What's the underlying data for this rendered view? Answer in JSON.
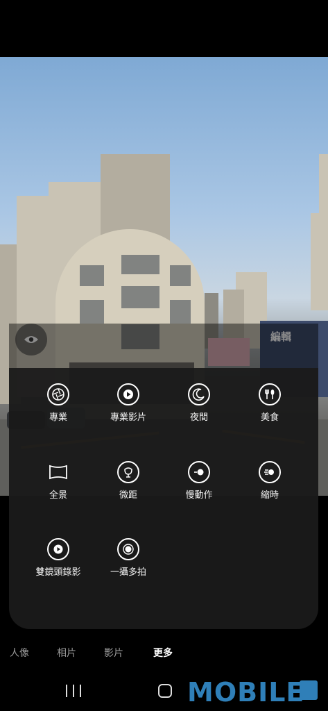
{
  "viewfinder": {
    "edit_label": "編輯"
  },
  "modes": [
    {
      "label": "專業",
      "icon": "aperture-icon"
    },
    {
      "label": "專業影片",
      "icon": "video-play-icon"
    },
    {
      "label": "夜間",
      "icon": "moon-icon"
    },
    {
      "label": "美食",
      "icon": "food-utensils-icon"
    },
    {
      "label": "全景",
      "icon": "panorama-icon"
    },
    {
      "label": "微距",
      "icon": "flower-icon"
    },
    {
      "label": "慢動作",
      "icon": "slow-motion-icon"
    },
    {
      "label": "縮時",
      "icon": "hyperlapse-icon"
    },
    {
      "label": "雙鏡頭錄影",
      "icon": "dual-record-icon"
    },
    {
      "label": "一攝多拍",
      "icon": "single-take-icon"
    }
  ],
  "tabs": [
    {
      "label": "人像"
    },
    {
      "label": "相片"
    },
    {
      "label": "影片"
    },
    {
      "label": "更多",
      "active": true
    }
  ],
  "watermark": "MOBILE",
  "colors": {
    "watermark": "#2f7fb8",
    "panel": "#1a1a1a"
  }
}
